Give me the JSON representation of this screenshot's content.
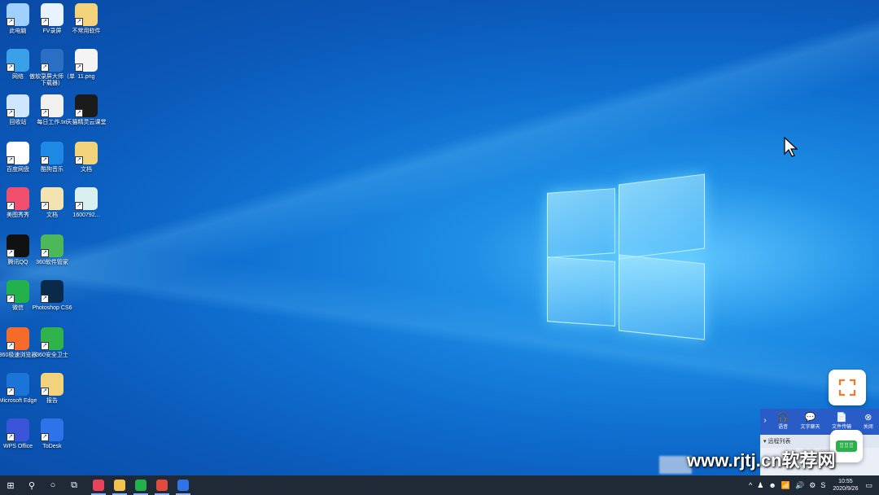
{
  "desktop": {
    "icons": [
      {
        "label": "此电脑",
        "icon": "computer-icon",
        "color": "#9fd0ff"
      },
      {
        "label": "FV录屏",
        "icon": "fv-recorder-icon",
        "color": "#e8f3ff"
      },
      {
        "label": "不常用软件",
        "icon": "folder-icon",
        "color": "#f2d27a"
      },
      {
        "label": "网络",
        "icon": "network-globe-icon",
        "color": "#3aa0e8"
      },
      {
        "label": "傲软录屏大师（单下载器）",
        "icon": "recorder-m-icon",
        "color": "#2b6fc4"
      },
      {
        "label": "11.png",
        "icon": "image-file-icon",
        "color": "#f4f4f4"
      },
      {
        "label": "回收站",
        "icon": "recycle-bin-icon",
        "color": "#cfe6ff"
      },
      {
        "label": "每日工作.txt",
        "icon": "text-file-icon",
        "color": "#f0f0f0"
      },
      {
        "label": "天猫精灵云课堂",
        "icon": "tm-icon",
        "color": "#1b1b1b"
      },
      {
        "label": "百度网盘",
        "icon": "cloud-drive-icon",
        "color": "#ffffff"
      },
      {
        "label": "酷狗音乐",
        "icon": "kugou-icon",
        "color": "#1e88e5"
      },
      {
        "label": "文档",
        "icon": "folder-icon",
        "color": "#f2d27a"
      },
      {
        "label": "美图秀秀",
        "icon": "meitu-icon",
        "color": "#f0506e"
      },
      {
        "label": "文档",
        "icon": "document-icon",
        "color": "#f2e3b0"
      },
      {
        "label": "1600792...",
        "icon": "image-thumb-icon",
        "color": "#d8f0f0"
      },
      {
        "label": "腾讯QQ",
        "icon": "qq-penguin-icon",
        "color": "#111111"
      },
      {
        "label": "360软件管家",
        "icon": "software-manager-icon",
        "color": "#4db85a"
      },
      {
        "label": "微信",
        "icon": "wechat-icon",
        "color": "#22b14c"
      },
      {
        "label": "Photoshop CS6",
        "icon": "photoshop-icon",
        "color": "#0a2a4a"
      },
      {
        "label": "360极速浏览器",
        "icon": "browser-360-icon",
        "color": "#f46b2b"
      },
      {
        "label": "360安全卫士",
        "icon": "shield-360-icon",
        "color": "#2fb34a"
      },
      {
        "label": "Microsoft Edge",
        "icon": "edge-icon",
        "color": "#1b74d8"
      },
      {
        "label": "报告",
        "icon": "folder-icon",
        "color": "#f2d27a"
      },
      {
        "label": "WPS Office",
        "icon": "wps-icon",
        "color": "#3a55d8"
      },
      {
        "label": "ToDesk",
        "icon": "todesk-icon",
        "color": "#2e73e8"
      }
    ]
  },
  "remote_panel": {
    "tools": [
      {
        "label": "语音",
        "glyph": "🎧"
      },
      {
        "label": "文字聊天",
        "glyph": "💬"
      },
      {
        "label": "文件传输",
        "glyph": "📄"
      },
      {
        "label": "关闭",
        "glyph": "⊗"
      }
    ],
    "list_header": "远程列表"
  },
  "taskbar": {
    "start_glyph": "⊞",
    "search_glyph": "⚲",
    "cortana_glyph": "○",
    "taskview_glyph": "⧉",
    "apps": [
      {
        "name": "app-screen-recorder",
        "color": "#e8435a"
      },
      {
        "name": "app-file-explorer",
        "color": "#f2c14e"
      },
      {
        "name": "app-wechat",
        "color": "#22b14c"
      },
      {
        "name": "app-chrome",
        "color": "#e24b3b"
      },
      {
        "name": "app-todesk",
        "color": "#2e73e8"
      }
    ],
    "tray_icons": [
      "^",
      "♟",
      "☻",
      "📶",
      "🔊",
      "⚙",
      "S"
    ],
    "time": "10:55",
    "date": "2020/9/26",
    "notification_glyph": "▭"
  },
  "watermark": "www.rjtj.cn软荐网",
  "colors": {
    "accent": "#0f6fd0",
    "taskbar": "#1f2a36"
  }
}
